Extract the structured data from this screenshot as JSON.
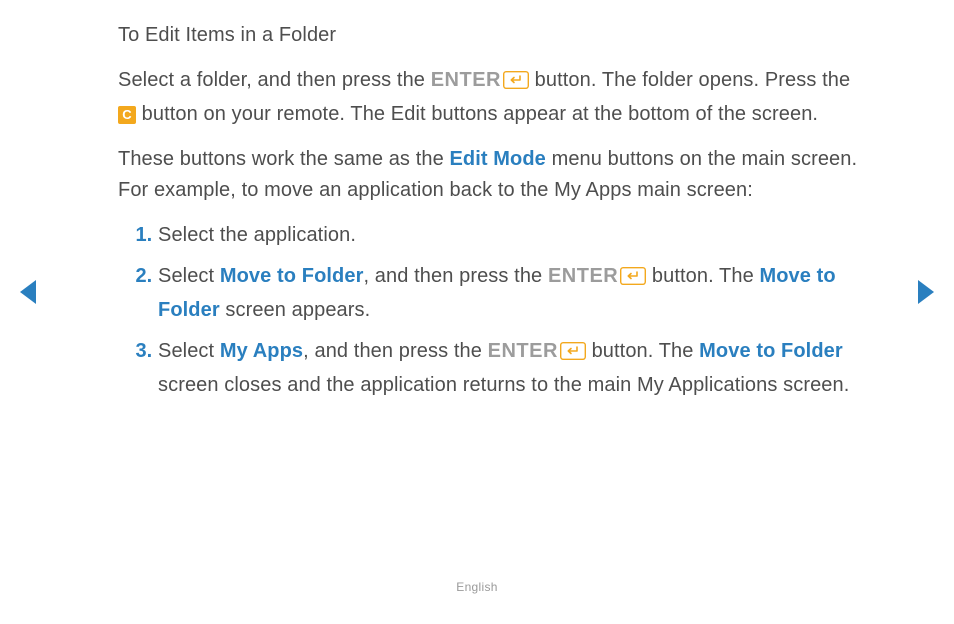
{
  "title": "To Edit Items in a Folder",
  "para1": {
    "t1": "Select a folder, and then press the ",
    "enter": "ENTER",
    "t2": " button. The folder opens. Press the ",
    "c_label": "C",
    "t3": " button on your remote. The Edit buttons appear at the bottom of the screen."
  },
  "para2": {
    "t1": "These buttons work the same as the ",
    "h1": "Edit Mode",
    "t2": " menu buttons on the main screen. For example, to move an application back to the My Apps main screen:"
  },
  "steps": {
    "s1": "Select the application.",
    "s2": {
      "t1": "Select ",
      "h1": "Move to Folder",
      "t2": ", and then press the ",
      "enter": "ENTER",
      "t3": " button. The ",
      "h2": "Move to Folder",
      "t4": " screen appears."
    },
    "s3": {
      "t1": "Select ",
      "h1": "My Apps",
      "t2": ", and then press the ",
      "enter": "ENTER",
      "t3": " button. The ",
      "h2": "Move to Folder",
      "t4": " screen closes and the application returns to the main My Applications screen."
    }
  },
  "footer": "English"
}
